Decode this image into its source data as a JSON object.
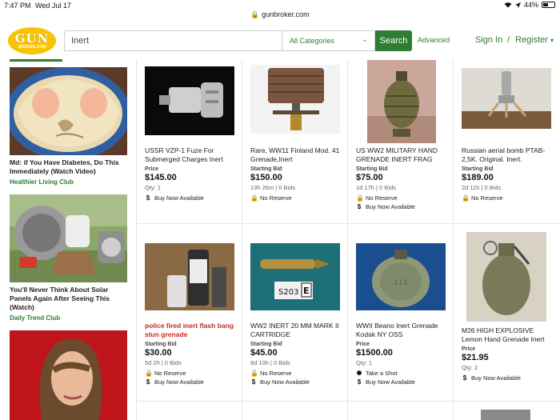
{
  "status": {
    "time": "7:47 PM",
    "date": "Wed Jul 17",
    "battery": "44%",
    "battery_level": 0.44
  },
  "browser": {
    "url": "gunbroker.com"
  },
  "header": {
    "logo_top": "GUN",
    "logo_bottom": "BROKER.COM",
    "search_value": "Inert",
    "category": "All Categories",
    "search_button": "Search",
    "advanced": "Advanced",
    "sign_in": "Sign In",
    "separator": "/",
    "register": "Register"
  },
  "sidebar_ads": [
    {
      "title": "Md: if You Have Diabetes, Do This Immediately (Watch Video)",
      "source": "Healthier Living Club"
    },
    {
      "title": "You'll Never Think About Solar Panels Again After Seeing This (Watch)",
      "source": "Daily Trend Club"
    },
    {
      "title": "",
      "source": ""
    }
  ],
  "listings": [
    {
      "title": "USSR VZP-1 Fuze For Submerged Charges Inert",
      "price_label": "Price",
      "price": "$145.00",
      "meta": "Qty: 1",
      "features": [
        {
          "icon": "dollar-icon",
          "text": "Buy Now Available"
        }
      ]
    },
    {
      "title": "Rare, WW11 Finland Mod. 41 Grenade,Inert",
      "price_label": "Starting Bid",
      "price": "$150.00",
      "meta": "13h 26m | 0 Bids",
      "features": [
        {
          "icon": "lock-icon",
          "text": "No Reserve"
        }
      ]
    },
    {
      "title": "US WW2 MILITARY HAND GRENADE INERT FRAG",
      "price_label": "Starting Bid",
      "price": "$75.00",
      "meta": "1d 17h | 0 Bids",
      "features": [
        {
          "icon": "lock-icon",
          "text": "No Reserve"
        },
        {
          "icon": "dollar-icon",
          "text": "Buy Now Available"
        }
      ]
    },
    {
      "title": "Russian aerial bomb PTAB-2,5K. Original. Inert.",
      "price_label": "Starting Bid",
      "price": "$189.00",
      "meta": "2d 11h | 0 Bids",
      "features": [
        {
          "icon": "lock-icon",
          "text": "No Reserve"
        }
      ]
    },
    {
      "title": "police fired inert flash bang stun grenade",
      "price_label": "Starting Bid",
      "price": "$30.00",
      "meta": "5d 2h | 0 Bids",
      "features": [
        {
          "icon": "lock-icon",
          "text": "No Reserve"
        },
        {
          "icon": "dollar-icon",
          "text": "Buy Now Available"
        }
      ]
    },
    {
      "title": "WW2 INERT 20 MM MARK II CARTRIDGE",
      "price_label": "Starting Bid",
      "price": "$45.00",
      "meta": "6d 10h | 0 Bids",
      "features": [
        {
          "icon": "lock-icon",
          "text": "No Reserve"
        },
        {
          "icon": "dollar-icon",
          "text": "Buy Now Available"
        }
      ]
    },
    {
      "title": "WWII Beano Inert Grenade Kodak NY OSS",
      "price_label": "Price",
      "price": "$1500.00",
      "meta": "Qty: 1",
      "features": [
        {
          "icon": "offer-icon",
          "text": "Take a Shot"
        },
        {
          "icon": "dollar-icon",
          "text": "Buy Now Available"
        }
      ]
    },
    {
      "title": "M26 HIGH EXPLOSIVE Lemon Hand Grenade Inert",
      "price_label": "Price",
      "price": "$21.95",
      "meta": "Qty: 2",
      "features": [
        {
          "icon": "dollar-icon",
          "text": "Buy Now Available"
        }
      ]
    }
  ],
  "image_text": {
    "cartridge_tag": "S203",
    "cartridge_letter": "E",
    "beano_mark": "113"
  },
  "colors": {
    "accent": "#2e7d32",
    "logo": "#f6c400",
    "alert_title": "#c62828"
  }
}
